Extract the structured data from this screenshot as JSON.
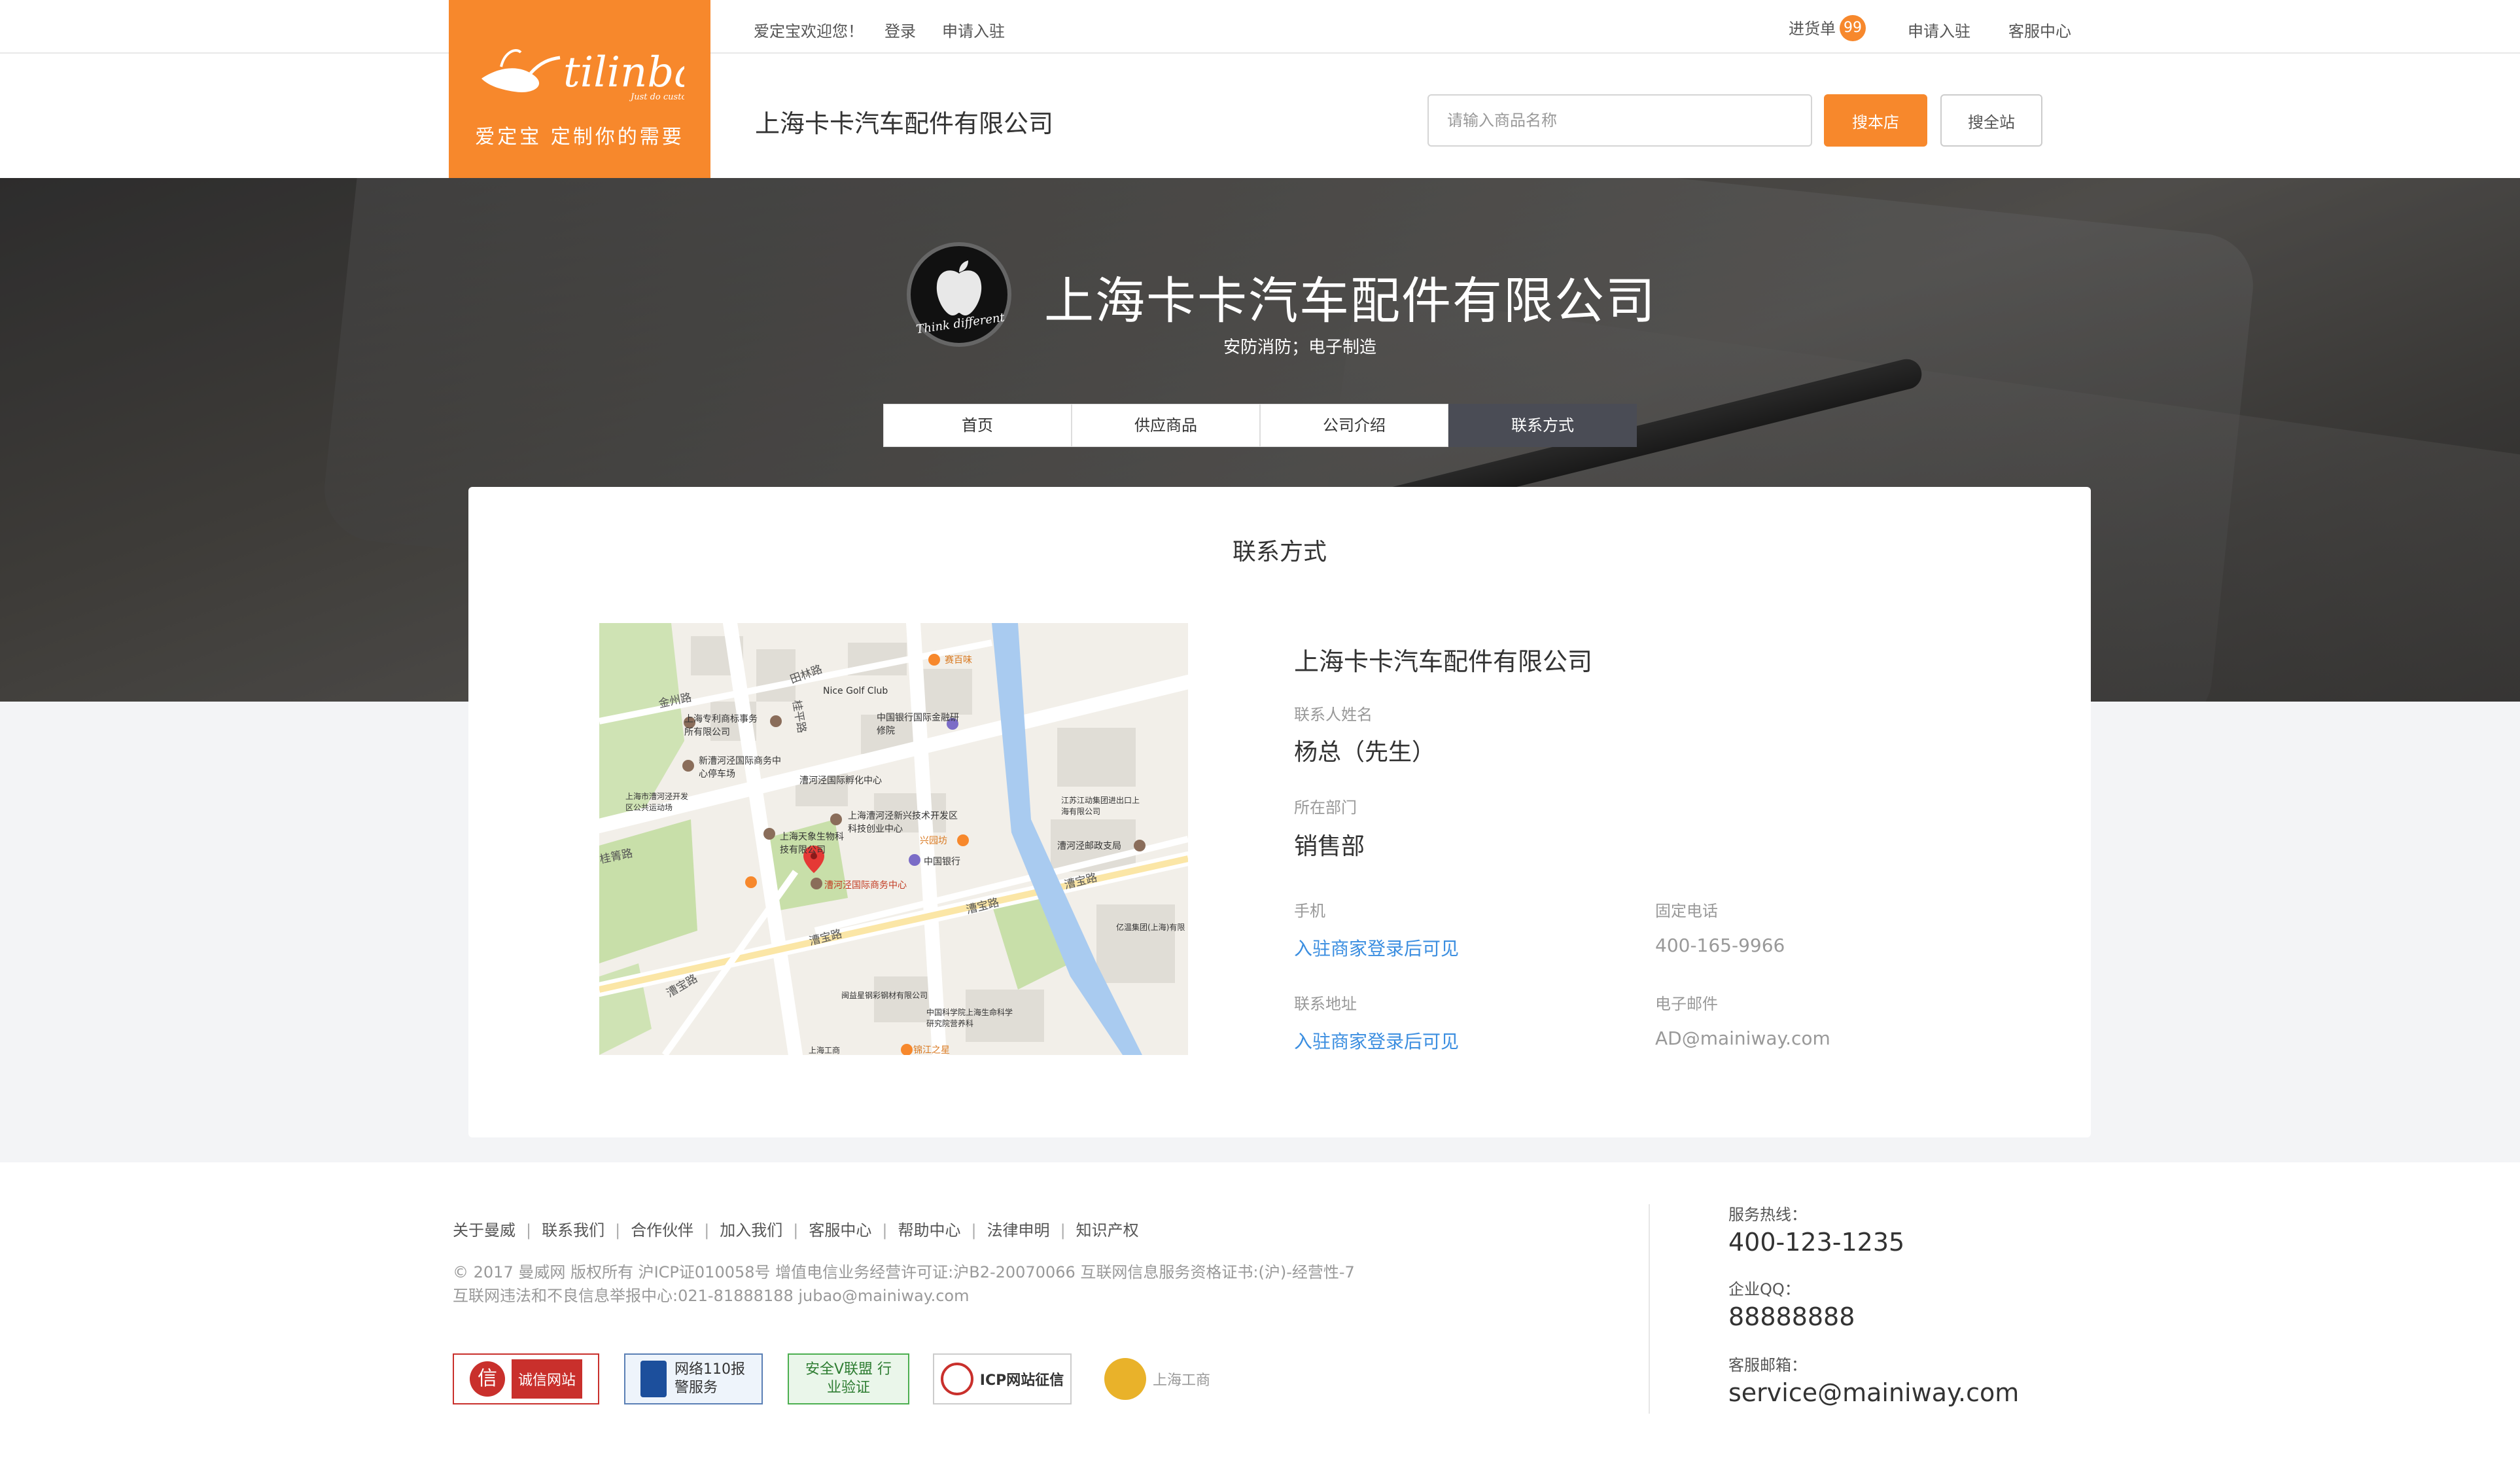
{
  "topbar": {
    "welcome": "爱定宝欢迎您！",
    "login": "登录",
    "apply": "申请入驻",
    "cart_label": "进货单",
    "cart_count": "99",
    "apply_right": "申请入驻",
    "service_center": "客服中心"
  },
  "logo": {
    "brand_text": "tilinbao",
    "brand_sub": "Just do custom",
    "slogan": "爱定宝 定制你的需要"
  },
  "header": {
    "company_name": "上海卡卡汽车配件有限公司",
    "search_placeholder": "请输入商品名称",
    "search_store_label": "搜本店",
    "search_all_label": "搜全站"
  },
  "banner": {
    "shop_logo_caption": "Think different",
    "shop_name": "上海卡卡汽车配件有限公司",
    "tags": "安防消防；电子制造",
    "tabs": [
      {
        "label": "首页",
        "active": false
      },
      {
        "label": "供应商品",
        "active": false
      },
      {
        "label": "公司介绍",
        "active": false
      },
      {
        "label": "联系方式",
        "active": true
      }
    ]
  },
  "contact": {
    "title": "联系方式",
    "company": "上海卡卡汽车配件有限公司",
    "contact_name_label": "联系人姓名",
    "contact_name": "杨总（先生）",
    "department_label": "所在部门",
    "department": "销售部",
    "mobile_label": "手机",
    "mobile_value": "入驻商家登录后可见",
    "phone_label": "固定电话",
    "phone_value": "400-165-9966",
    "address_label": "联系地址",
    "address_value": "入驻商家登录后可见",
    "email_label": "电子邮件",
    "email_value": "AD@mainiway.com"
  },
  "map": {
    "labels": {
      "golf": "Nice Golf Club",
      "bank_china_training": "中国银行国际金融研修院",
      "patent_office": "上海专利商标事务所有限公司",
      "xinjinghe_parking": "新漕河泾国际商务中心停车场",
      "incubator": "漕河泾国际孵化中心",
      "kaifa_district": "上海市漕河泾开发区公共运动场",
      "xinxing_tech": "上海漕河泾新兴技术开发区科技创业中心",
      "bio_tech": "上海天象生物科技有限公司",
      "xinxingfang": "兴园坊",
      "boc": "中国银行",
      "business_center": "漕河泾国际商务中心",
      "post_office": "漕河泾邮政支局",
      "jiangsu_branch": "江苏江动集团进出口上海有限公司",
      "yiyuan": "亿温集团(上海)有限",
      "saibaiwei": "赛百味",
      "steel_company": "闽益星钢彩钢材有限公司",
      "cas_institute": "中国科学院上海生命科学研究院营养科",
      "shanghai_industry": "上海工商",
      "jinling": "锦江之星"
    },
    "roads": {
      "jinzhou": "金州路",
      "guiqing": "桂箐路",
      "caobao": "漕宝路",
      "caobao2": "漕宝路",
      "caobao3": "漕宝路",
      "caobao4": "漕宝路",
      "guiping": "桂平路",
      "tianlin": "田林路"
    }
  },
  "footer": {
    "links": [
      "关于曼威",
      "联系我们",
      "合作伙伴",
      "加入我们",
      "客服中心",
      "帮助中心",
      "法律申明",
      "知识产权"
    ],
    "copyright1": "© 2017 曼威网 版权所有  沪ICP证010058号   增值电信业务经营许可证:沪B2-20070066     互联网信息服务资格证书:(沪)-经营性-7",
    "copyright2": "互联网违法和不良信息举报中心:021-81888188 jubao@mainiway.com",
    "hotline_label": "服务热线：",
    "hotline": "400-123-1235",
    "qq_label": "企业QQ：",
    "qq": "88888888",
    "email_label": "客服邮箱：",
    "email": "service@mainiway.com",
    "badges": [
      "诚信网站",
      "网络110报警服务",
      "安全V联盟 行业验证",
      "ICP网站征信",
      "上海工商"
    ]
  },
  "colors": {
    "accent": "#f7882c",
    "link": "#3b8ee0",
    "nav_active": "#4a4c55"
  }
}
